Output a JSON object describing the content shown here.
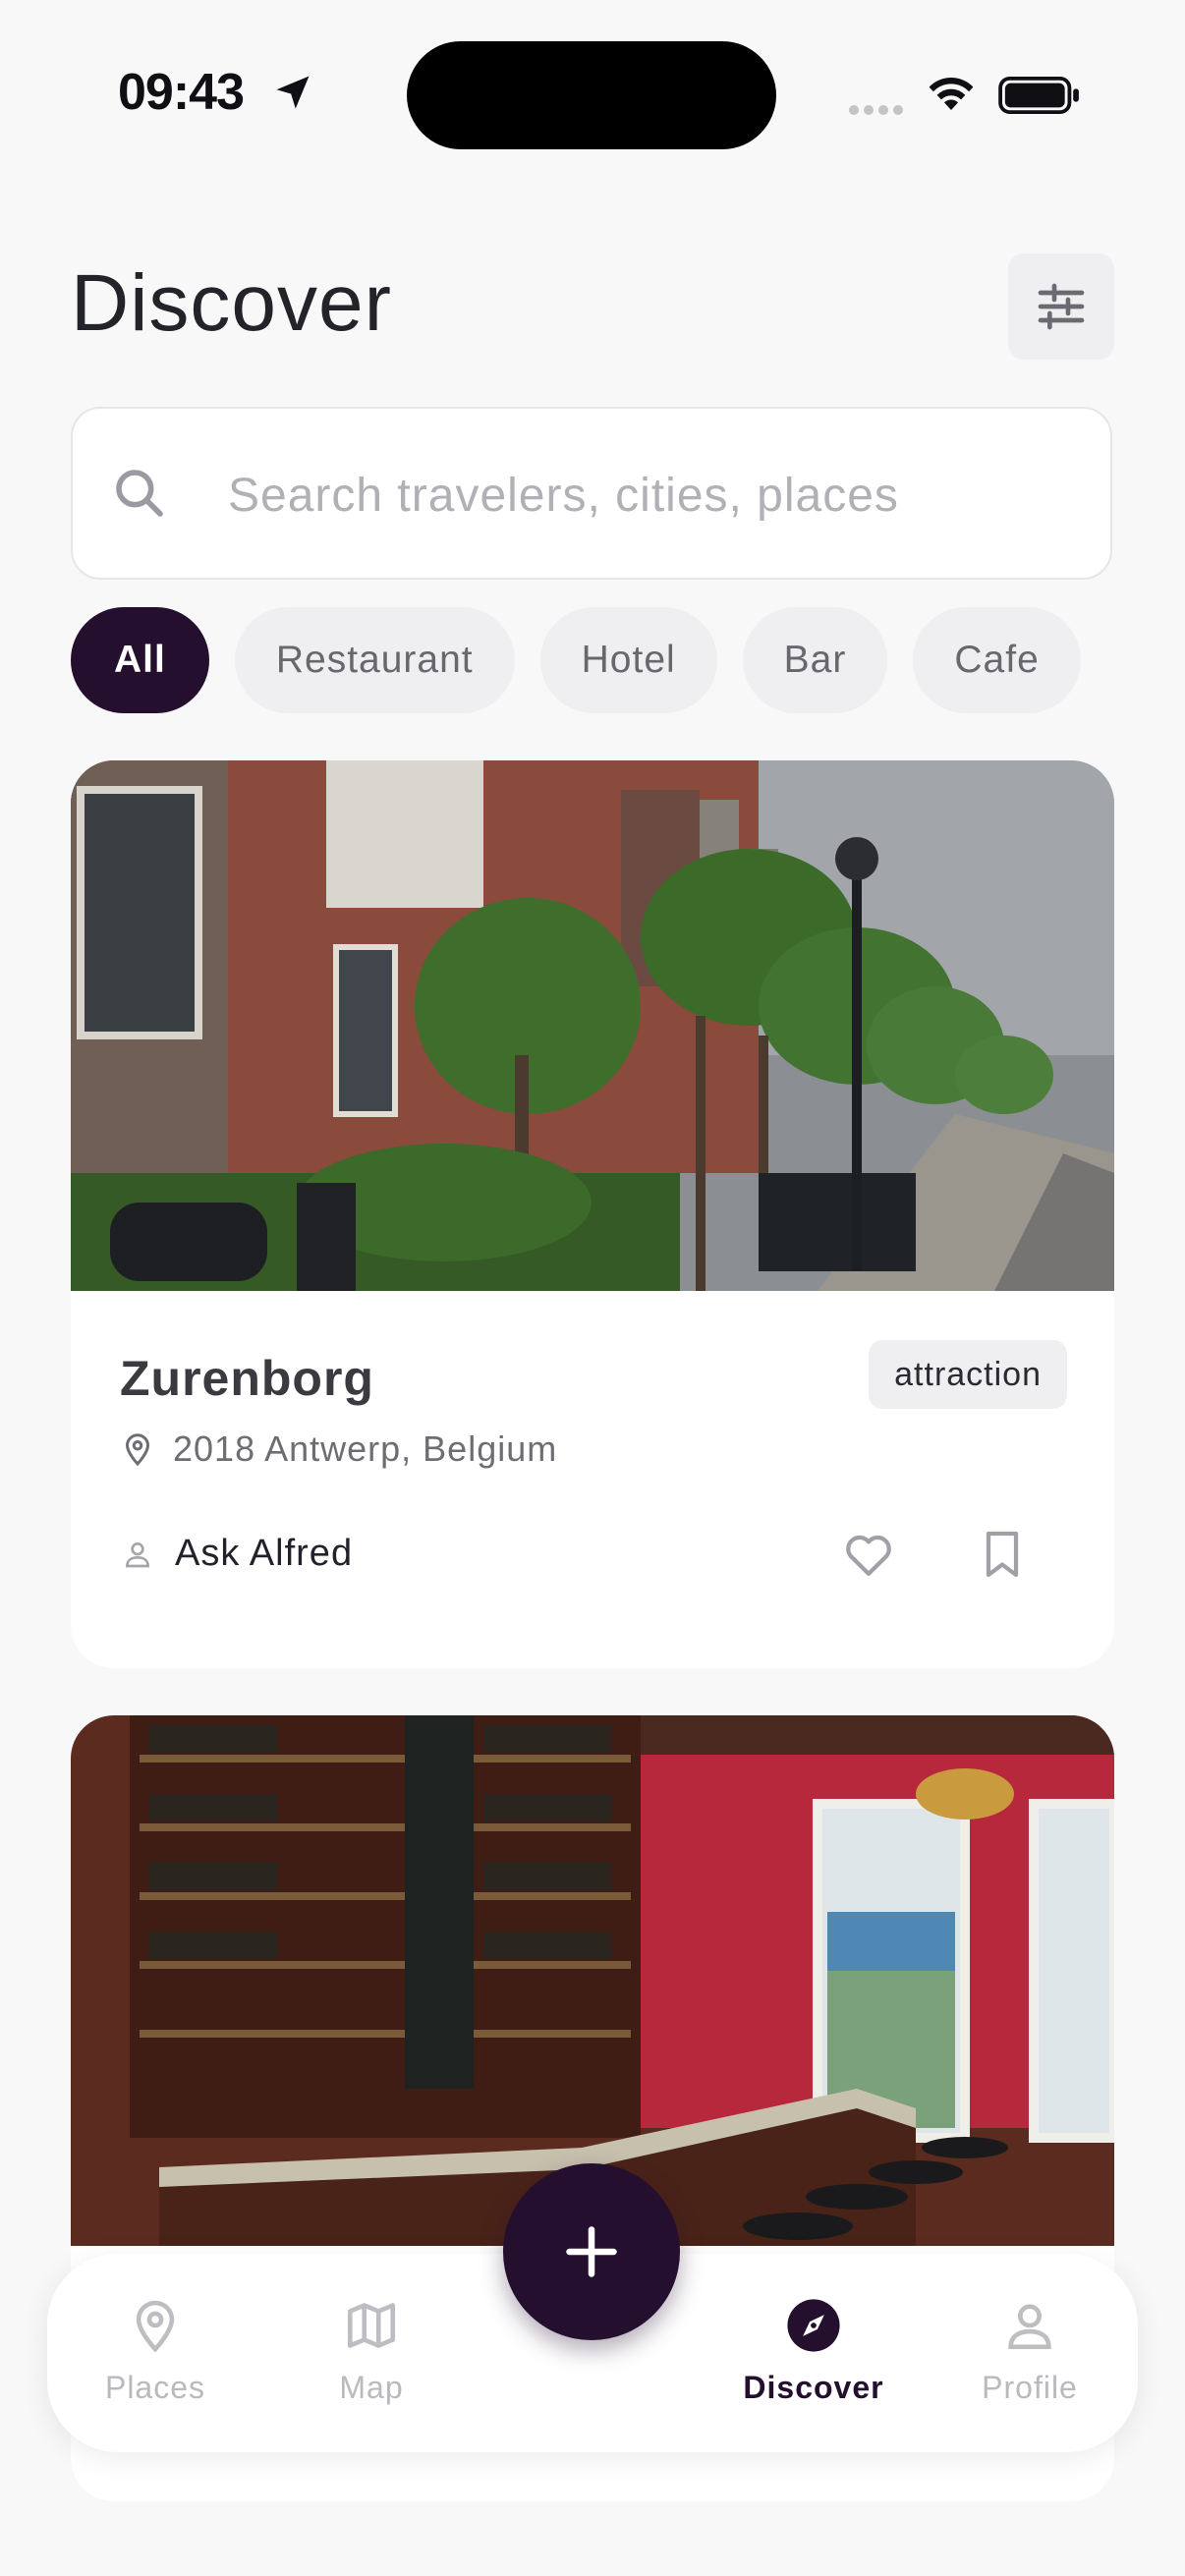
{
  "status_bar": {
    "time": "09:43"
  },
  "header": {
    "title": "Discover"
  },
  "search": {
    "placeholder": "Search travelers, cities, places",
    "value": ""
  },
  "chips": [
    {
      "label": "All",
      "active": true
    },
    {
      "label": "Restaurant",
      "active": false
    },
    {
      "label": "Hotel",
      "active": false
    },
    {
      "label": "Bar",
      "active": false
    },
    {
      "label": "Cafe",
      "active": false
    }
  ],
  "cards": [
    {
      "name": "Zurenborg",
      "category": "attraction",
      "address": "2018 Antwerp, Belgium",
      "author": "Ask Alfred",
      "image": "street-with-trees-photo"
    },
    {
      "image": "bar-interior-photo"
    }
  ],
  "nav": {
    "items": [
      {
        "label": "Places",
        "icon": "map-pin-icon",
        "active": false
      },
      {
        "label": "Map",
        "icon": "map-icon",
        "active": false
      },
      {
        "label": "Discover",
        "icon": "compass-icon",
        "active": true
      },
      {
        "label": "Profile",
        "icon": "user-icon",
        "active": false
      }
    ],
    "fab_icon": "plus-icon"
  },
  "colors": {
    "accent": "#24102e",
    "background": "#f8f8f9",
    "chip_background": "#efeff1",
    "muted_text": "#b9b9be"
  }
}
